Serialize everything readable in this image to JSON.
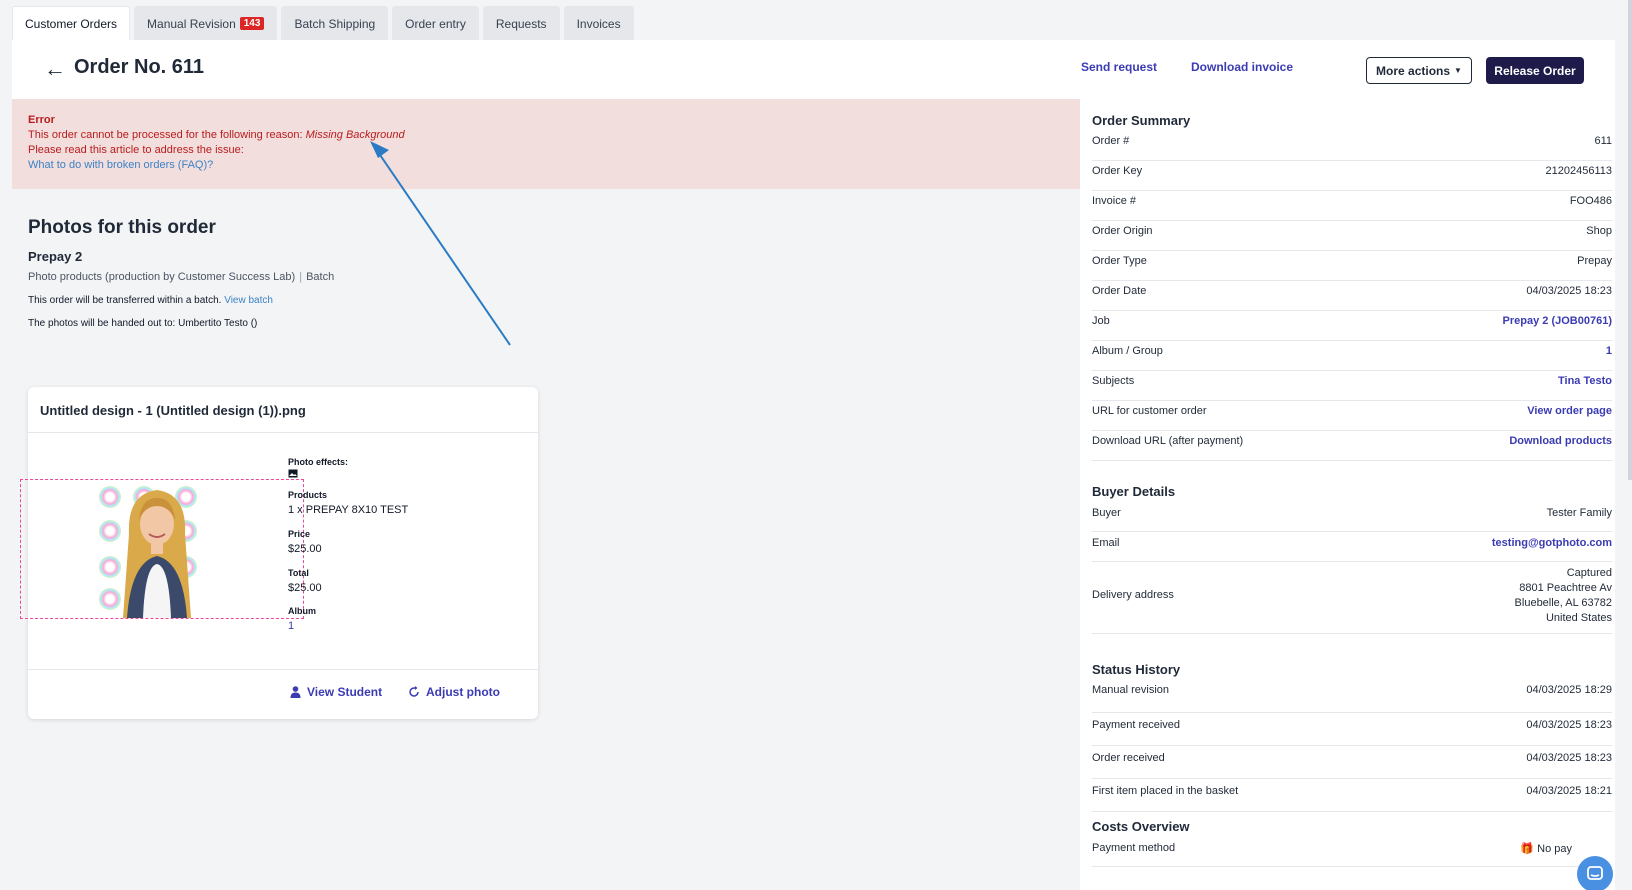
{
  "tabs": [
    {
      "label": "Customer Orders"
    },
    {
      "label": "Manual Revision",
      "badge": "143"
    },
    {
      "label": "Batch Shipping"
    },
    {
      "label": "Order entry"
    },
    {
      "label": "Requests"
    },
    {
      "label": "Invoices"
    }
  ],
  "header": {
    "title": "Order No. 611",
    "send_request": "Send request",
    "download_invoice": "Download invoice",
    "more_actions": "More actions",
    "release_order": "Release Order"
  },
  "error": {
    "title": "Error",
    "line1": "This order cannot be processed for the following reason:",
    "reason": "Missing Background",
    "line2": "Please read this article to address the issue:",
    "faq_link": "What to do with broken orders (FAQ)?"
  },
  "photos": {
    "title": "Photos for this order",
    "job_name": "Prepay 2",
    "production": "Photo products (production by Customer Success Lab)",
    "batch": "Batch",
    "transfer_text": "This order will be transferred within a batch.",
    "view_batch": "View batch",
    "handed_out": "The photos will be handed out to: Umbertito Testo ()"
  },
  "card": {
    "title": "Untitled design - 1 (Untitled design (1)).png",
    "photo_effects_label": "Photo effects:",
    "products_label": "Products",
    "products_value": "1 x PREPAY 8X10 TEST",
    "price_label": "Price",
    "price_value": "$25.00",
    "total_label": "Total",
    "total_value": "$25.00",
    "album_label": "Album",
    "album_value": "1",
    "view_student": "View Student",
    "adjust_photo": "Adjust photo"
  },
  "order_summary": {
    "title": "Order Summary",
    "rows": [
      {
        "k": "Order #",
        "v": "611"
      },
      {
        "k": "Order Key",
        "v": "21202456113"
      },
      {
        "k": "Invoice #",
        "v": "FOO486"
      },
      {
        "k": "Order Origin",
        "v": "Shop"
      },
      {
        "k": "Order Type",
        "v": "Prepay"
      },
      {
        "k": "Order Date",
        "v": "04/03/2025 18:23"
      },
      {
        "k": "Job",
        "v": "Prepay 2 (JOB00761)"
      },
      {
        "k": "Album / Group",
        "v": "1"
      },
      {
        "k": "Subjects",
        "v": "Tina Testo"
      },
      {
        "k": "URL for customer order",
        "v": "View order page"
      },
      {
        "k": "Download URL (after payment)",
        "v": "Download products"
      }
    ]
  },
  "buyer": {
    "title": "Buyer Details",
    "buyer_k": "Buyer",
    "buyer_v": "Tester Family",
    "email_k": "Email",
    "email_v": "testing@gotphoto.com",
    "address_k": "Delivery address",
    "address_lines": [
      "Captured",
      "8801 Peachtree Av",
      "Bluebelle, AL 63782",
      "United States"
    ]
  },
  "status_history": {
    "title": "Status History",
    "rows": [
      {
        "k": "Manual revision",
        "v": "04/03/2025 18:29"
      },
      {
        "k": "Payment received",
        "v": "04/03/2025 18:23"
      },
      {
        "k": "Order received",
        "v": "04/03/2025 18:23"
      },
      {
        "k": "First item placed in the basket",
        "v": "04/03/2025 18:21"
      }
    ]
  },
  "costs": {
    "title": "Costs Overview",
    "payment_k": "Payment method",
    "payment_v": "No pay"
  },
  "colors": {
    "accent": "#3b3bb3",
    "primary_button": "#1e1b4b",
    "error_bg": "#f3dede",
    "error_text": "#b91c1c",
    "annotation_arrow": "#2b7bc4"
  }
}
